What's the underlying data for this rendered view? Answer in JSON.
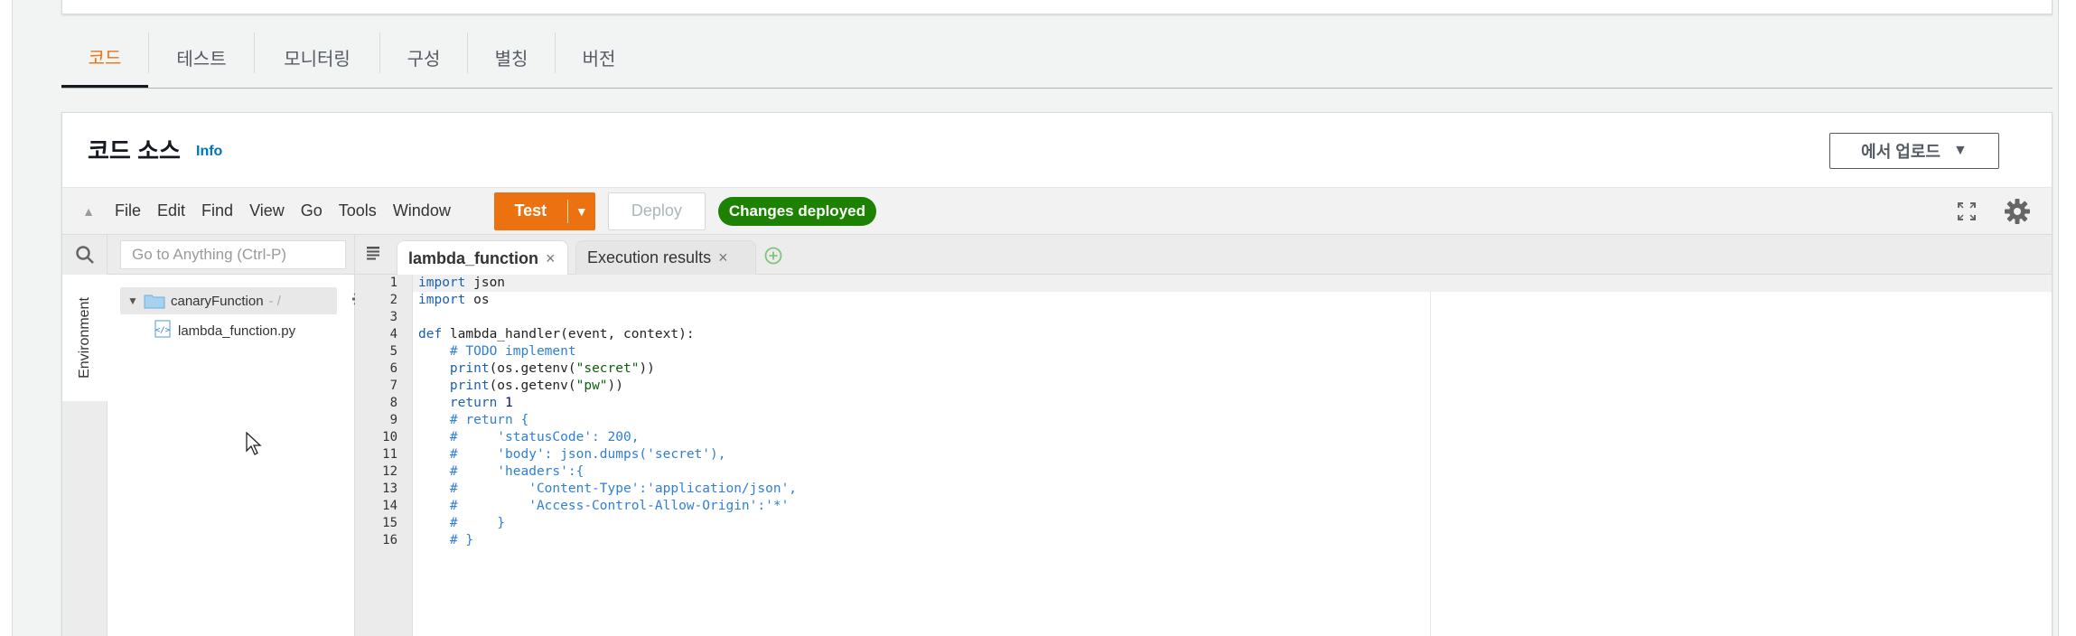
{
  "tabs": [
    {
      "label": "코드",
      "active": true
    },
    {
      "label": "테스트"
    },
    {
      "label": "모니터링"
    },
    {
      "label": "구성"
    },
    {
      "label": "별칭"
    },
    {
      "label": "버전"
    }
  ],
  "card": {
    "title": "코드 소스",
    "info": "Info",
    "upload_label": "에서 업로드"
  },
  "ide": {
    "menu": [
      "File",
      "Edit",
      "Find",
      "View",
      "Go",
      "Tools",
      "Window"
    ],
    "test_label": "Test",
    "deploy_label": "Deploy",
    "status": "Changes deployed",
    "goto_placeholder": "Go to Anything (Ctrl-P)",
    "environment_tab": "Environment",
    "tree": {
      "folder": "canaryFunction",
      "file": "lambda_function.py"
    },
    "editor_tabs": [
      "lambda_function",
      "Execution results"
    ],
    "line_numbers": [
      "1",
      "2",
      "3",
      "4",
      "5",
      "6",
      "7",
      "8",
      "9",
      "10",
      "11",
      "12",
      "13",
      "14",
      "15",
      "16"
    ],
    "code_lines": [
      "import json",
      "import os",
      "",
      "def lambda_handler(event, context):",
      "    # TODO implement",
      "    print(os.getenv(\"secret\"))",
      "    print(os.getenv(\"pw\"))",
      "    return 1",
      "    # return {",
      "    #     'statusCode': 200,",
      "    #     'body': json.dumps('secret'),",
      "    #     'headers':{",
      "    #         'Content-Type':'application/json',",
      "    #         'Access-Control-Allow-Origin':'*'",
      "    #     }",
      "    # }"
    ]
  },
  "colors": {
    "accent": "#ec7211",
    "success": "#1d8102",
    "link": "#0073bb"
  },
  "icons": [
    "search-icon",
    "folder-icon",
    "gear-icon",
    "file-icon",
    "fullscreen-icon",
    "settings-icon",
    "add-tab-icon",
    "close-icon",
    "mouse-cursor-icon"
  ]
}
